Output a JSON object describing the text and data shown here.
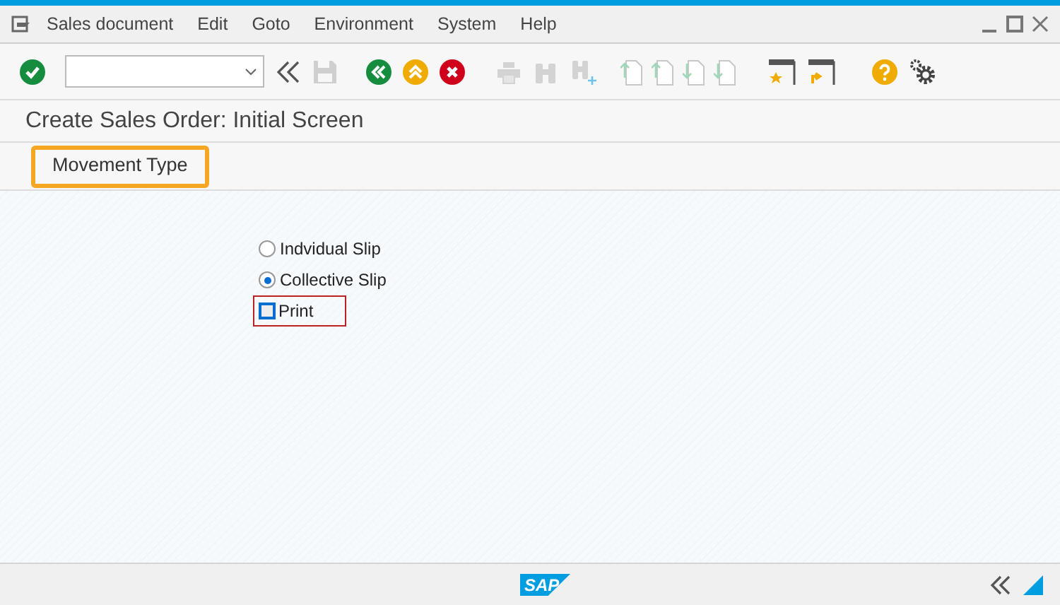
{
  "menu_bar": {
    "items": [
      "Sales document",
      "Edit",
      "Goto",
      "Environment",
      "System",
      "Help"
    ]
  },
  "title": "Create Sales Order: Initial Screen",
  "app_toolbar": {
    "buttons": [
      {
        "label": "Movement Type",
        "selected": true
      }
    ]
  },
  "options": [
    {
      "kind": "radio",
      "label": "Indvidual Slip",
      "selected": false
    },
    {
      "kind": "radio",
      "label": "Collective Slip",
      "selected": true
    },
    {
      "kind": "checkbox",
      "label": "Print",
      "checked": false,
      "focused": true
    }
  ],
  "status_bar": {
    "logo": "SAP"
  }
}
